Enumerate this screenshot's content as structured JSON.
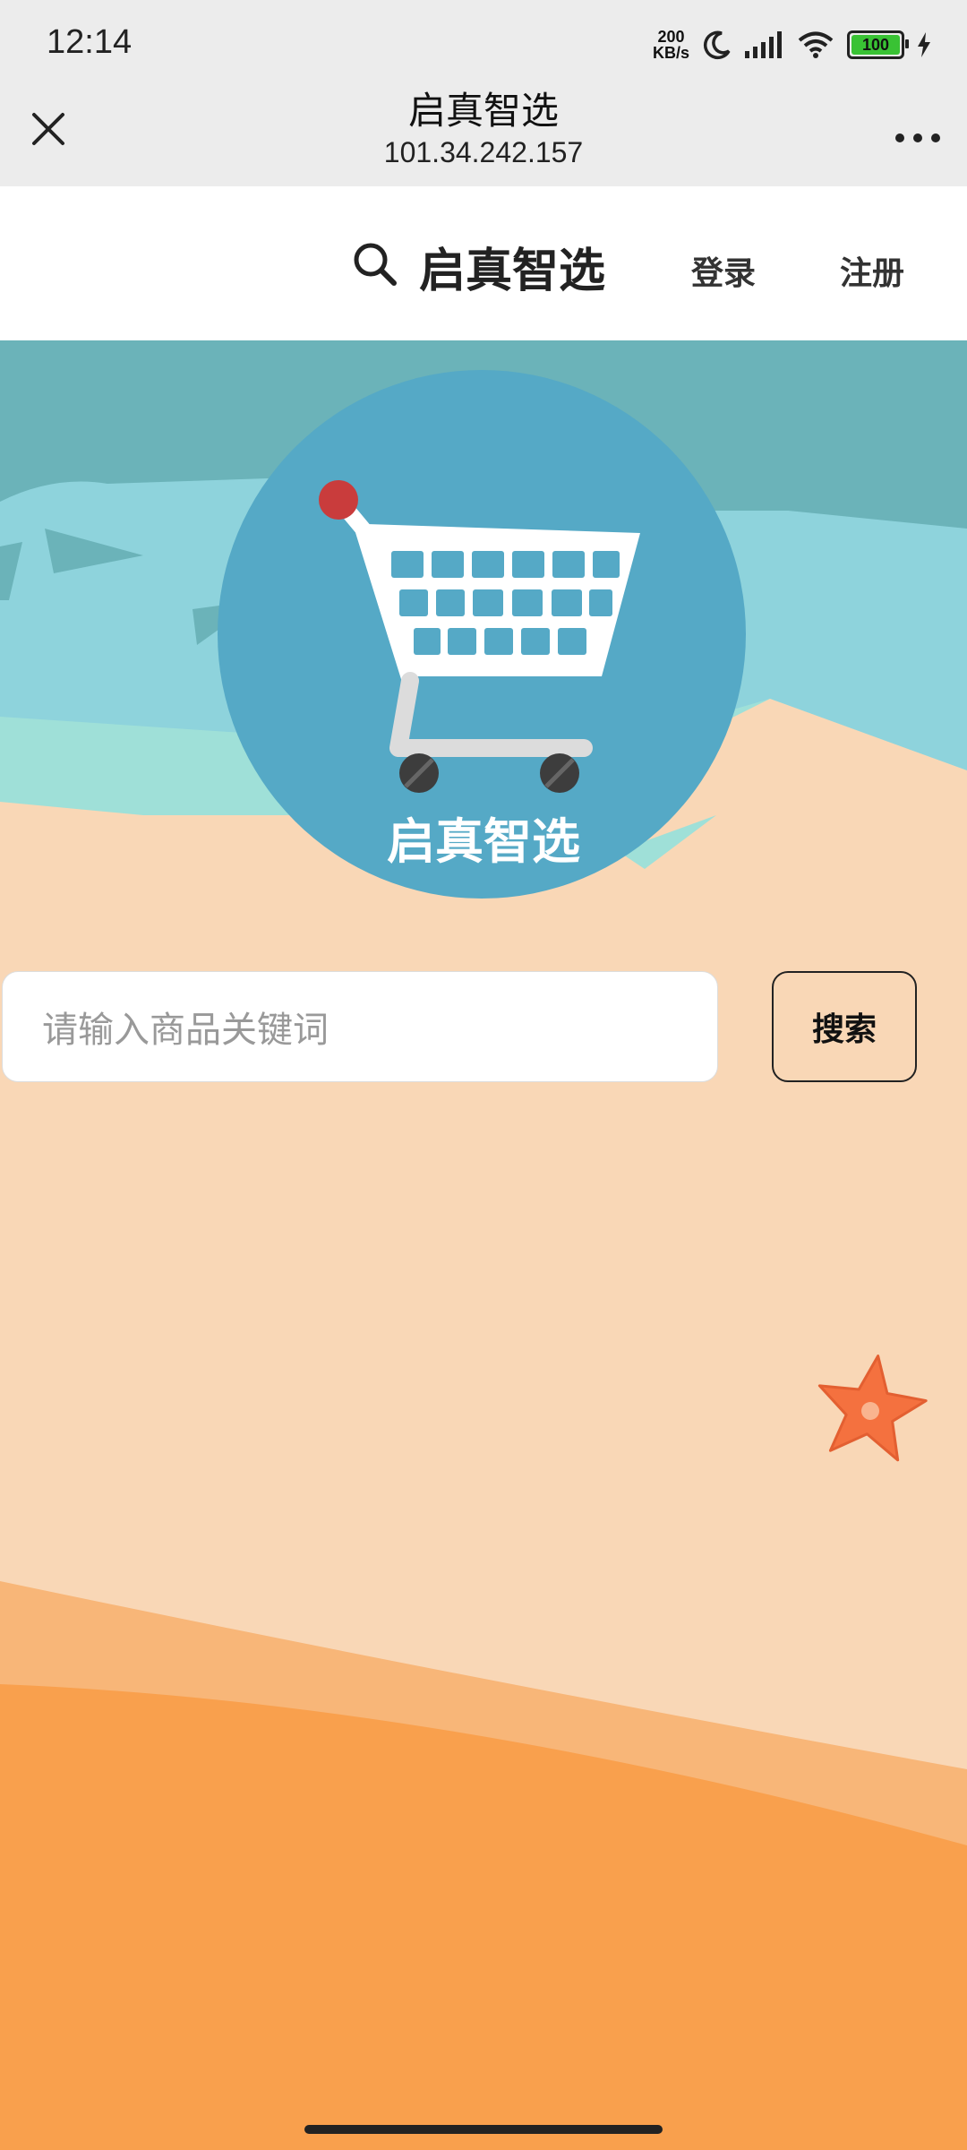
{
  "status": {
    "time": "12:14",
    "net_speed_top": "200",
    "net_speed_bottom": "KB/s",
    "battery": "100"
  },
  "titlebar": {
    "title": "启真智选",
    "subtitle": "101.34.242.157"
  },
  "nav": {
    "brand": "启真智选",
    "login": "登录",
    "register": "注册"
  },
  "hero": {
    "logo_text": "启真智选"
  },
  "search": {
    "placeholder": "请输入商品关键词",
    "button": "搜索"
  },
  "colors": {
    "sky": "#6bb3b9",
    "wave_light": "#8ed3dc",
    "wave_mint": "#9fe0d8",
    "sand": "#f9d7b6",
    "sand_mid": "#f8b678",
    "sand_dark": "#f9a04d",
    "logo_circle": "#55a9c6",
    "starfish": "#f4713f"
  }
}
